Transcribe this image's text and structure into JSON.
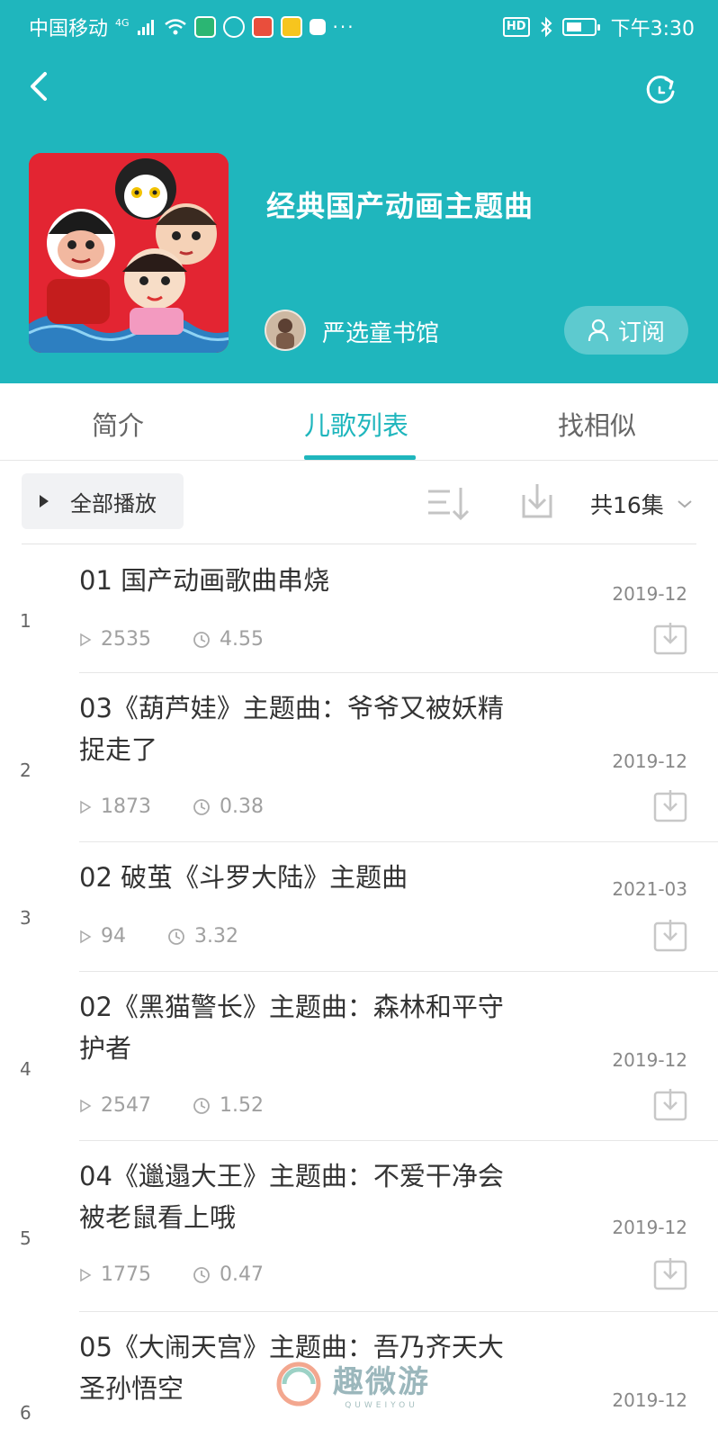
{
  "status_bar": {
    "carrier": "中国移动",
    "network": "4G",
    "hd": "HD",
    "time": "下午3:30",
    "apps": [
      {
        "name": "app-icon-1",
        "color": "#2bb673"
      },
      {
        "name": "app-icon-2",
        "color": "#ffffff"
      },
      {
        "name": "app-icon-3",
        "color": "#e94e3c"
      },
      {
        "name": "weibo-icon",
        "color": "#f7c51e"
      },
      {
        "name": "book-icon",
        "color": "#ffffff"
      }
    ]
  },
  "header": {
    "album_title": "经典国产动画主题曲",
    "author": "严选童书馆",
    "subscribe_label": "订阅",
    "colors": {
      "brand": "#1fb6bd"
    }
  },
  "tabs": [
    {
      "label": "简介",
      "active": false
    },
    {
      "label": "儿歌列表",
      "active": true
    },
    {
      "label": "找相似",
      "active": false
    }
  ],
  "toolbar": {
    "play_all_label": "全部播放",
    "count_label": "共16集"
  },
  "tracks": [
    {
      "index": "1",
      "title": "01 国产动画歌曲串烧",
      "date": "2019-12",
      "plays": "2535",
      "duration": "4.55"
    },
    {
      "index": "2",
      "title": "03《葫芦娃》主题曲：爷爷又被妖精捉走了",
      "date": "2019-12",
      "plays": "1873",
      "duration": "0.38"
    },
    {
      "index": "3",
      "title": "02 破茧《斗罗大陆》主题曲",
      "date": "2021-03",
      "plays": "94",
      "duration": "3.32"
    },
    {
      "index": "4",
      "title": "02《黑猫警长》主题曲：森林和平守护者",
      "date": "2019-12",
      "plays": "2547",
      "duration": "1.52"
    },
    {
      "index": "5",
      "title": "04《邋遢大王》主题曲：不爱干净会被老鼠看上哦",
      "date": "2019-12",
      "plays": "1775",
      "duration": "0.47"
    },
    {
      "index": "6",
      "title": "05《大闹天宫》主题曲：吾乃齐天大圣孙悟空",
      "date": "2019-12",
      "plays": "",
      "duration": ""
    }
  ],
  "watermark": {
    "text": "趣微游",
    "sub": "QUWEIYOU"
  }
}
